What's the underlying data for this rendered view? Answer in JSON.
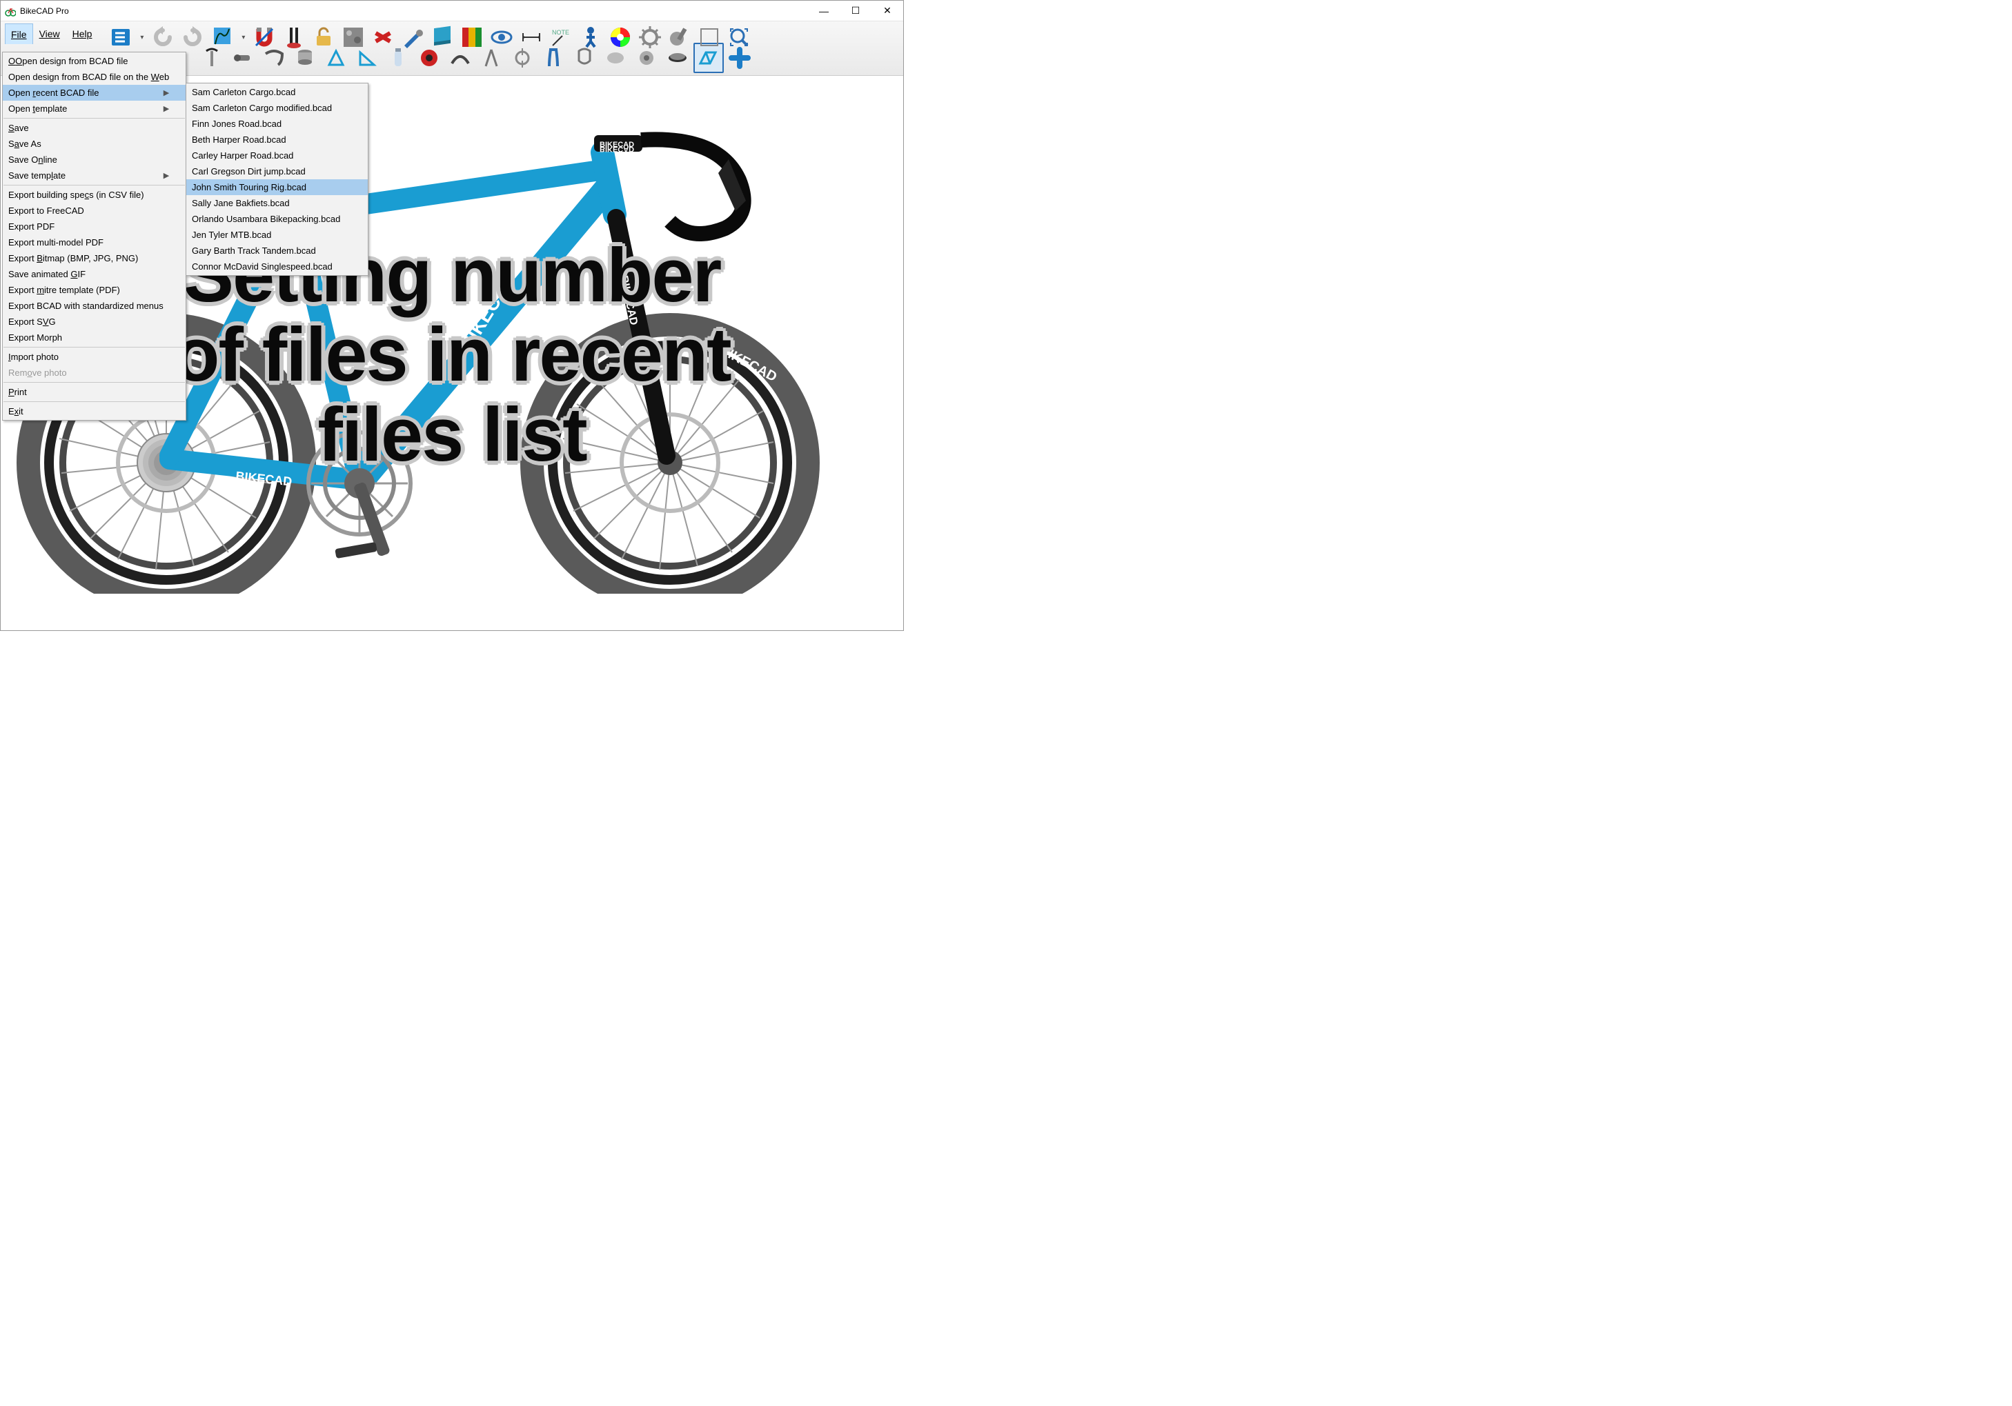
{
  "window": {
    "title": "BikeCAD Pro"
  },
  "menubar": {
    "file": "File",
    "view": "View",
    "help": "Help"
  },
  "file_menu": {
    "open_bcad": "Open design from BCAD file",
    "open_web": "Open design from BCAD file on the Web",
    "open_recent": "Open recent BCAD file",
    "open_template": "Open template",
    "save": "Save",
    "save_as": "Save As",
    "save_online": "Save Online",
    "save_template": "Save template",
    "export_csv": "Export building specs (in CSV file)",
    "export_freecad": "Export to FreeCAD",
    "export_pdf": "Export PDF",
    "export_multi_pdf": "Export multi-model PDF",
    "export_bitmap": "Export Bitmap (BMP, JPG, PNG)",
    "save_gif": "Save animated GIF",
    "export_mitre": "Export mitre template (PDF)",
    "export_std": "Export BCAD with standardized menus",
    "export_svg": "Export SVG",
    "export_morph": "Export Morph",
    "import_photo": "Import photo",
    "remove_photo": "Remove photo",
    "print": "Print",
    "exit": "Exit"
  },
  "recent_files": [
    "Sam Carleton Cargo.bcad",
    "Sam Carleton Cargo modified.bcad",
    "Finn Jones Road.bcad",
    "Beth Harper Road.bcad",
    "Carley Harper Road.bcad",
    "Carl Gregson Dirt jump.bcad",
    "John Smith Touring Rig.bcad",
    "Sally Jane Bakfiets.bcad",
    "Orlando Usambara Bikepacking.bcad",
    "Jen Tyler MTB.bcad",
    "Gary Barth Track Tandem.bcad",
    "Connor McDavid Singlespeed.bcad"
  ],
  "recent_selected_index": 6,
  "overlay": {
    "line1": "Setting number",
    "line2": "of files in recent",
    "line3": "files list"
  },
  "bike": {
    "frame_label_top": "BIKECAD",
    "frame_label_down": "BIKECAD",
    "frame_label_chain": "BIKECAD",
    "fork_label": "BIKECAD",
    "tire_label": "BIKECAD",
    "stem_label": "BIKECAD",
    "frame_color": "#1a9dd2",
    "tire_color": "#5a5a5a",
    "rim_color": "#202020"
  },
  "toolbar_icons_row1": [
    "shape-split",
    "undo",
    "redo",
    "brush-split",
    "magnet",
    "fork-flip",
    "lock-open",
    "texture",
    "wrench",
    "pen",
    "book",
    "color-swatch",
    "eye",
    "dimension",
    "note",
    "rider",
    "color-wheel",
    "gear",
    "crank",
    "square",
    "zoom"
  ],
  "toolbar_icons_row2": [
    "seatpost",
    "stem",
    "handlebar",
    "headset",
    "front-triangle",
    "rear-triangle",
    "bottle",
    "bb",
    "chainstay",
    "seatstay",
    "dropout",
    "fork",
    "brake",
    "misc1",
    "misc2",
    "headset2",
    "frame",
    "plus"
  ]
}
